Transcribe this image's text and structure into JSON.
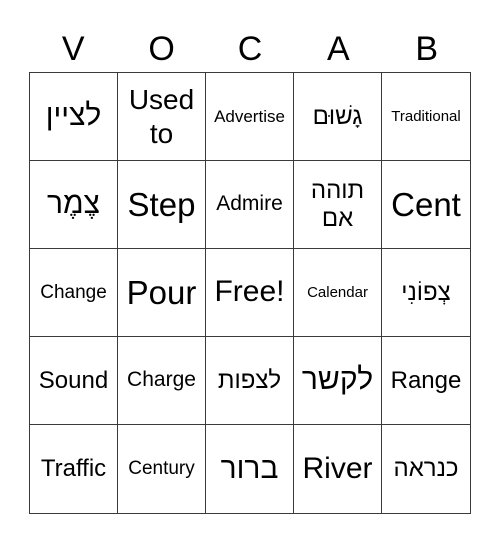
{
  "card": {
    "header_letters": [
      "V",
      "O",
      "C",
      "A",
      "B"
    ],
    "rows": [
      [
        {
          "text": "לציין",
          "rtl": true,
          "size": "s-l"
        },
        {
          "text": "Used to",
          "rtl": false,
          "size": "s-lm"
        },
        {
          "text": "Advertise",
          "rtl": false,
          "size": "s-xs"
        },
        {
          "text": "גָשׁוּם",
          "rtl": true,
          "size": "s-m"
        },
        {
          "text": "Traditional",
          "rtl": false,
          "size": "s-xxs"
        }
      ],
      [
        {
          "text": "צֶמֶר",
          "rtl": true,
          "size": "s-l"
        },
        {
          "text": "Step",
          "rtl": false,
          "size": "s-xl"
        },
        {
          "text": "Admire",
          "rtl": false,
          "size": "s-sm"
        },
        {
          "text": "תוהה אם",
          "rtl": true,
          "size": "s-m"
        },
        {
          "text": "Cent",
          "rtl": false,
          "size": "s-xl"
        }
      ],
      [
        {
          "text": "Change",
          "rtl": false,
          "size": "s-s"
        },
        {
          "text": "Pour",
          "rtl": false,
          "size": "s-xl"
        },
        {
          "text": "Free!",
          "rtl": false,
          "size": "s-l"
        },
        {
          "text": "Calendar",
          "rtl": false,
          "size": "s-xxs"
        },
        {
          "text": "צְפוֹנִי",
          "rtl": true,
          "size": "s-m"
        }
      ],
      [
        {
          "text": "Sound",
          "rtl": false,
          "size": "s-m"
        },
        {
          "text": "Charge",
          "rtl": false,
          "size": "s-sm"
        },
        {
          "text": "לצפות",
          "rtl": true,
          "size": "s-m"
        },
        {
          "text": "לקשר",
          "rtl": true,
          "size": "s-l"
        },
        {
          "text": "Range",
          "rtl": false,
          "size": "s-m"
        }
      ],
      [
        {
          "text": "Traffic",
          "rtl": false,
          "size": "s-m"
        },
        {
          "text": "Century",
          "rtl": false,
          "size": "s-s"
        },
        {
          "text": "ברור",
          "rtl": true,
          "size": "s-l"
        },
        {
          "text": "River",
          "rtl": false,
          "size": "s-l"
        },
        {
          "text": "כנראה",
          "rtl": true,
          "size": "s-m"
        }
      ]
    ]
  }
}
